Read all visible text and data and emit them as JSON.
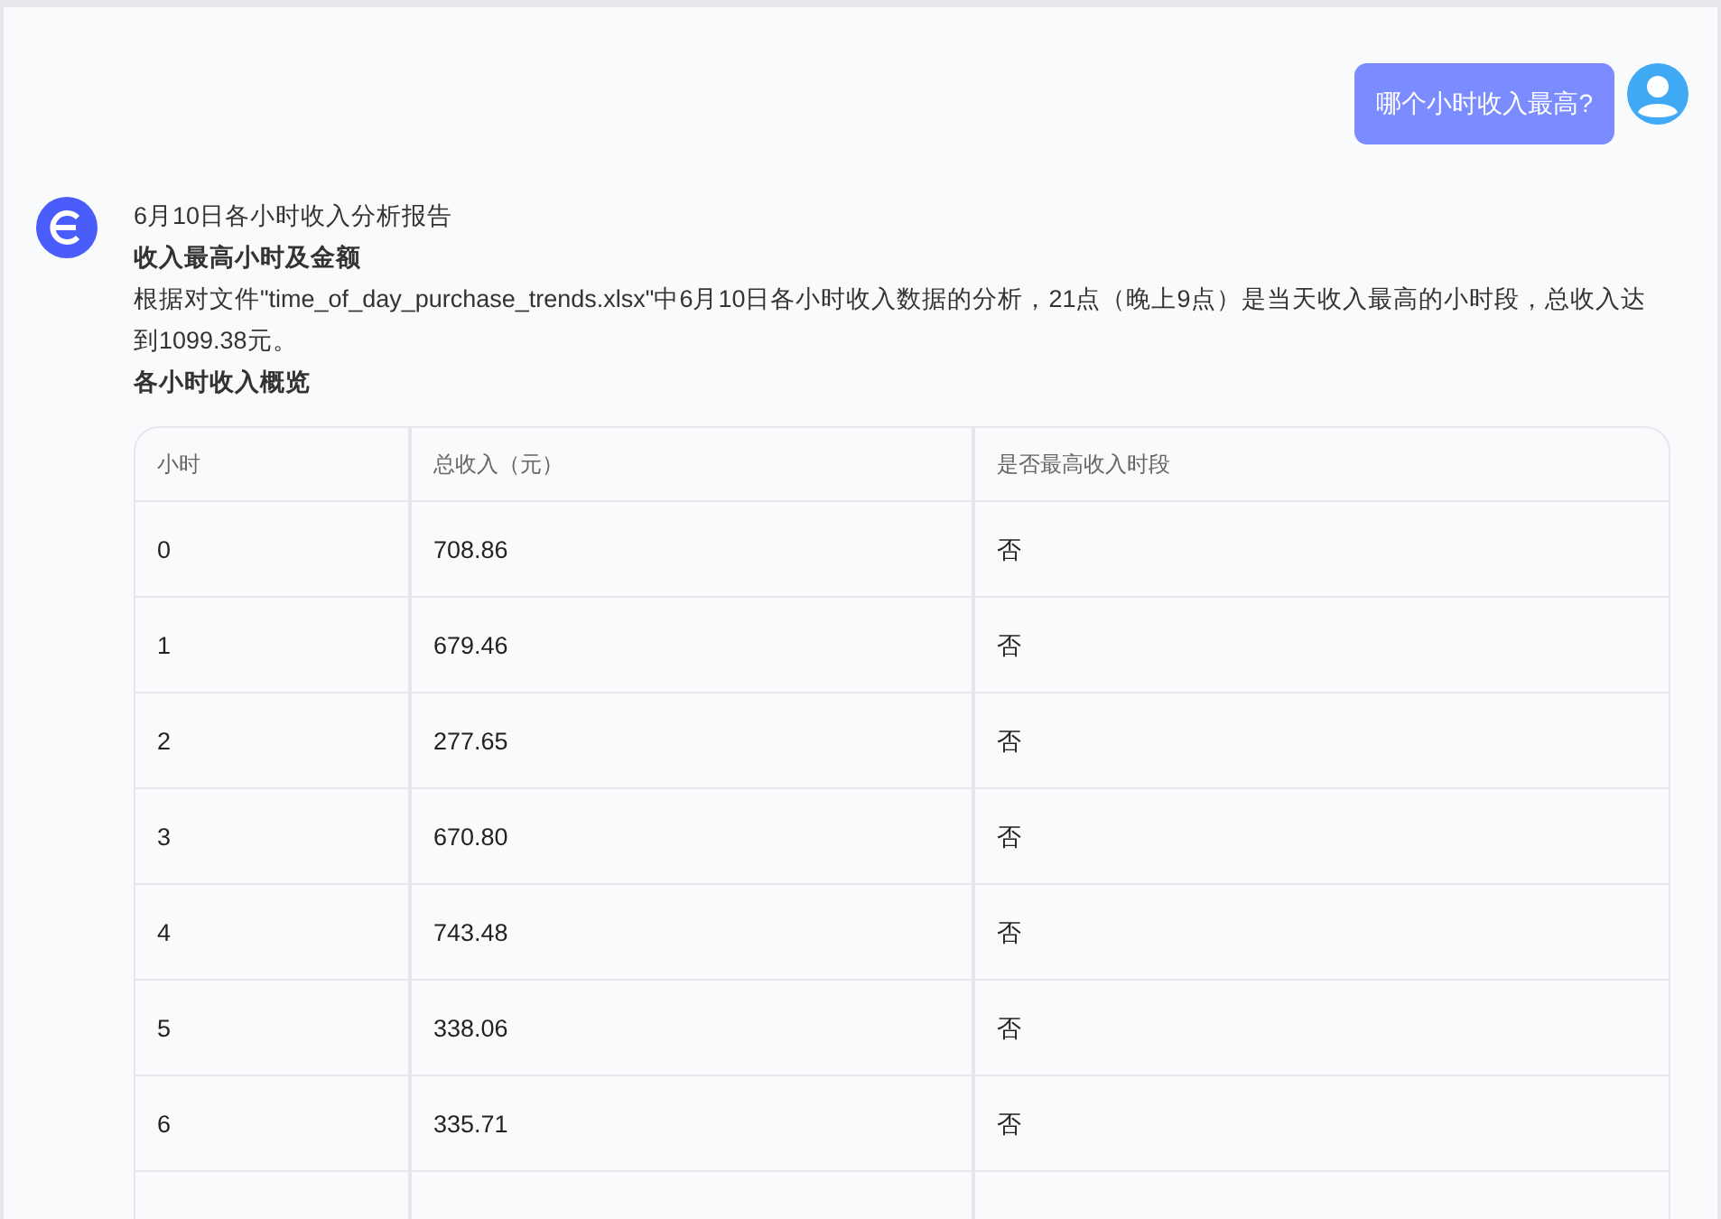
{
  "user_message": {
    "text": "哪个小时收入最高?"
  },
  "reply": {
    "title": "6月10日各小时收入分析报告",
    "heading_1": "收入最高小时及金额",
    "paragraph": "根据对文件\"time_of_day_purchase_trends.xlsx\"中6月10日各小时收入数据的分析，21点（晚上9点）是当天收入最高的小时段，总收入达到1099.38元。",
    "heading_2": "各小时收入概览",
    "table": {
      "columns": [
        "小时",
        "总收入（元）",
        "是否最高收入时段"
      ],
      "rows": [
        [
          "0",
          "708.86",
          "否"
        ],
        [
          "1",
          "679.46",
          "否"
        ],
        [
          "2",
          "277.65",
          "否"
        ],
        [
          "3",
          "670.80",
          "否"
        ],
        [
          "4",
          "743.48",
          "否"
        ],
        [
          "5",
          "338.06",
          "否"
        ],
        [
          "6",
          "335.71",
          "否"
        ]
      ]
    }
  }
}
